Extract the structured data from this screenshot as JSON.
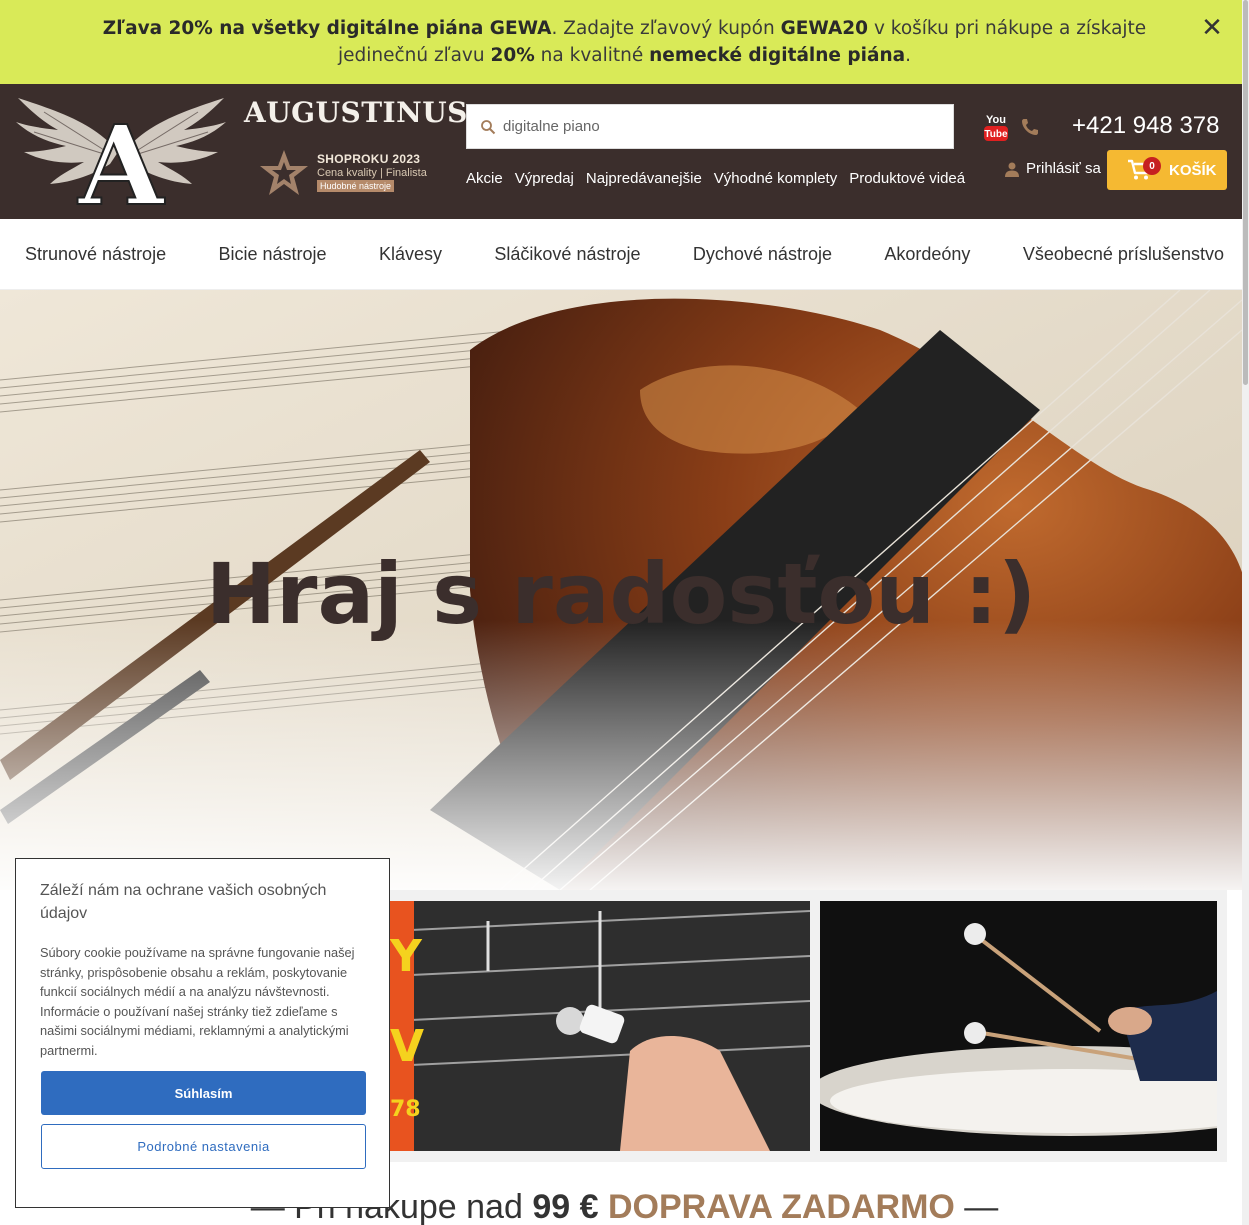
{
  "promo": {
    "p1": "Zľava 20% na všetky digitálne piána GEWA",
    "p2": ". Zadajte zľavový kupón ",
    "p3": "GEWA20",
    "p4": " v košíku pri nákupe a získajte jedinečnú zľavu ",
    "p5": "20%",
    "p6": " na kvalitné ",
    "p7": "nemecké digitálne piána",
    "p8": ".",
    "close_symbol": "✕"
  },
  "header": {
    "brand": "AUGUSTINUS",
    "logo_letter": "A",
    "award_title": "SHOPROKU 2023",
    "award_sub": "Cena kvality | Finalista",
    "award_tag": "Hudobné nástroje",
    "search_placeholder": "digitalne piano",
    "quicklinks": [
      "Akcie",
      "Výpredaj",
      "Najpredávanejšie",
      "Výhodné komplety",
      "Produktové videá"
    ],
    "youtube_top": "You",
    "youtube_bottom": "Tube",
    "phone": "+421 948 378",
    "login": "Prihlásiť sa",
    "cart_count": "0",
    "cart_label": "KOŠÍK",
    "accent": "#f5b932"
  },
  "categories": [
    "Strunové nástroje",
    "Bicie nástroje",
    "Klávesy",
    "Sláčikové nástroje",
    "Dychové nástroje",
    "Akordeóny",
    "Všeobecné príslušenstvo"
  ],
  "hero": {
    "title": "Hraj s radosťou :)"
  },
  "banner1": {
    "fragment1": "Y",
    "fragment2": "V",
    "fragment3": "78"
  },
  "shipping": {
    "prefix": "— Pri nákupe nad ",
    "amount": "99 €",
    "free": "DOPRAVA ZADARMO",
    "suffix": " —"
  },
  "cookie": {
    "title": "Záleží nám na ochrane vašich osobných údajov",
    "body": "Súbory cookie používame na správne fungovanie našej stránky, prispôsobenie obsahu a reklám, poskytovanie funkcií sociálnych médií a na analýzu návštevnosti. Informácie o používaní našej stránky tiež zdieľame s našimi sociálnymi médiami, reklamnými a analytickými partnermi.",
    "accept": "Súhlasím",
    "settings": "Podrobné nastavenia"
  },
  "colors": {
    "promo_bg": "#d9ea58",
    "header_bg": "#3b2e2c",
    "brand_brown": "#a37c5a",
    "button_blue": "#2f6cbf"
  }
}
